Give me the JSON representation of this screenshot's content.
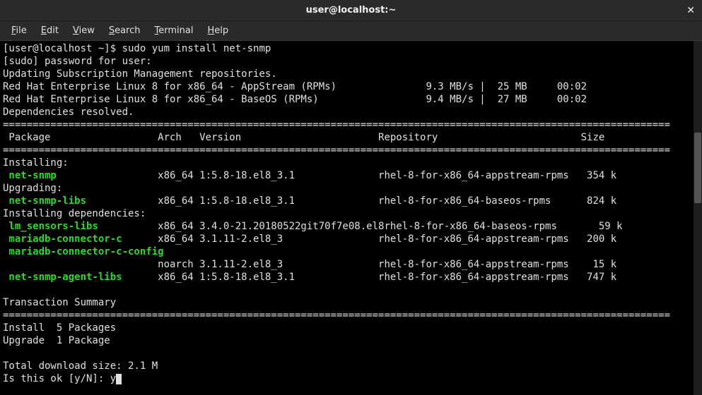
{
  "window": {
    "title": "user@localhost:~"
  },
  "menu": {
    "file": "File",
    "edit": "Edit",
    "view": "View",
    "search": "Search",
    "terminal": "Terminal",
    "help": "Help"
  },
  "prompt": {
    "ps1": "[user@localhost ~]$ ",
    "command": "sudo yum install net-snmp"
  },
  "lines": {
    "sudo_prompt": "[sudo] password for user:",
    "updating": "Updating Subscription Management repositories.",
    "repo1": "Red Hat Enterprise Linux 8 for x86_64 - AppStream (RPMs)               9.3 MB/s |  25 MB     00:02",
    "repo2": "Red Hat Enterprise Linux 8 for x86_64 - BaseOS (RPMs)                  9.4 MB/s |  27 MB     00:02",
    "deps_resolved": "Dependencies resolved.",
    "header": " Package                  Arch   Version                       Repository                        Size",
    "installing": "Installing:",
    "upgrading": "Upgrading:",
    "installing_deps": "Installing dependencies:",
    "tx_summary": "Transaction Summary",
    "install_count": "Install  5 Packages",
    "upgrade_count": "Upgrade  1 Package",
    "total_dl": "Total download size: 2.1 M",
    "confirm": "Is this ok [y/N]: ",
    "confirm_input": "y"
  },
  "pkgs": {
    "net_snmp": {
      "name": "net-snmp",
      "arch": "x86_64",
      "ver": "1:5.8-18.el8_3.1",
      "repo": "rhel-8-for-x86_64-appstream-rpms",
      "size": "354 k"
    },
    "net_snmp_libs": {
      "name": "net-snmp-libs",
      "arch": "x86_64",
      "ver": "1:5.8-18.el8_3.1",
      "repo": "rhel-8-for-x86_64-baseos-rpms",
      "size": "824 k"
    },
    "lm_sensors_libs": {
      "name": "lm_sensors-libs",
      "arch": "x86_64",
      "ver": "3.4.0-21.20180522git70f7e08.el8",
      "repo": "rhel-8-for-x86_64-baseos-rpms",
      "size": " 59 k"
    },
    "mariadb_connector_c": {
      "name": "mariadb-connector-c",
      "arch": "x86_64",
      "ver": "3.1.11-2.el8_3",
      "repo": "rhel-8-for-x86_64-appstream-rpms",
      "size": "200 k"
    },
    "mariadb_connector_c_cfg": {
      "name": "mariadb-connector-c-config",
      "arch": "noarch",
      "ver": "3.1.11-2.el8_3",
      "repo": "rhel-8-for-x86_64-appstream-rpms",
      "size": " 15 k"
    },
    "net_snmp_agent_libs": {
      "name": "net-snmp-agent-libs",
      "arch": "x86_64",
      "ver": "1:5.8-18.el8_3.1",
      "repo": "rhel-8-for-x86_64-appstream-rpms",
      "size": "747 k"
    }
  },
  "sep": "================================================================================================================"
}
